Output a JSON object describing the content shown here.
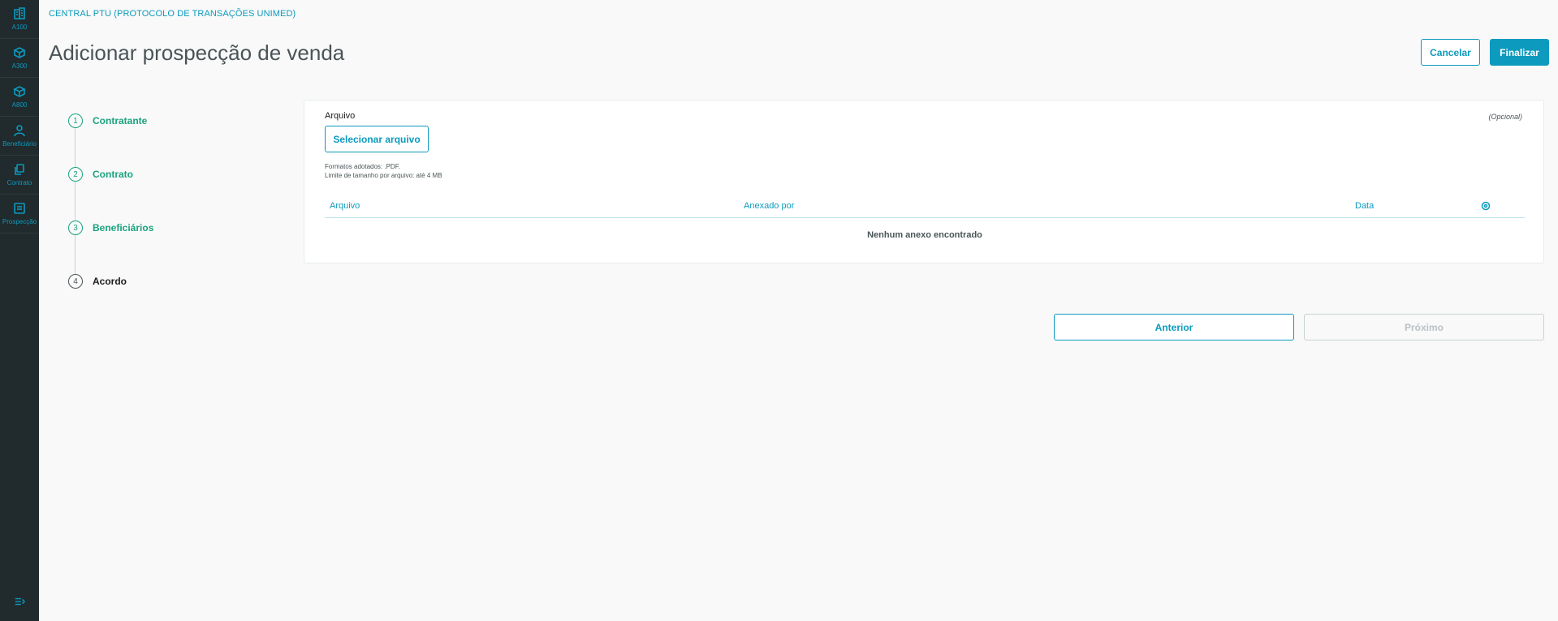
{
  "sidebar": {
    "items": [
      {
        "label": "A100",
        "icon": "building-icon"
      },
      {
        "label": "A300",
        "icon": "box-icon"
      },
      {
        "label": "A800",
        "icon": "cube-icon"
      },
      {
        "label": "Beneficiário",
        "icon": "user-icon"
      },
      {
        "label": "Contrato",
        "icon": "documents-icon"
      },
      {
        "label": "Prospecção",
        "icon": "clipboard-icon"
      }
    ],
    "toggle_icon": "menu-collapse-icon"
  },
  "header": {
    "breadcrumb": "CENTRAL PTU (PROTOCOLO DE TRANSAÇÕES UNIMED)",
    "title": "Adicionar prospecção de venda",
    "cancel_label": "Cancelar",
    "finish_label": "Finalizar"
  },
  "stepper": {
    "steps": [
      {
        "number": "1",
        "label": "Contratante",
        "state": "done"
      },
      {
        "number": "2",
        "label": "Contrato",
        "state": "done"
      },
      {
        "number": "3",
        "label": "Beneficiários",
        "state": "done"
      },
      {
        "number": "4",
        "label": "Acordo",
        "state": "current"
      }
    ]
  },
  "upload": {
    "label": "Arquivo",
    "optional": "(Opcional)",
    "select_button": "Selecionar arquivo",
    "formats_text": "Formatos adotados: .PDF.",
    "size_limit_text": "Limite de tamanho por arquivo: até 4 MB"
  },
  "table": {
    "columns": [
      "Arquivo",
      "Anexado por",
      "Data"
    ],
    "settings_icon": "gear-icon",
    "empty_text": "Nenhum anexo encontrado"
  },
  "footer": {
    "prev_label": "Anterior",
    "next_label": "Próximo"
  },
  "colors": {
    "primary": "#0c9abe",
    "success": "#1aa37e",
    "sidebar_bg": "#212a2c",
    "page_bg": "#f9f9f9"
  }
}
